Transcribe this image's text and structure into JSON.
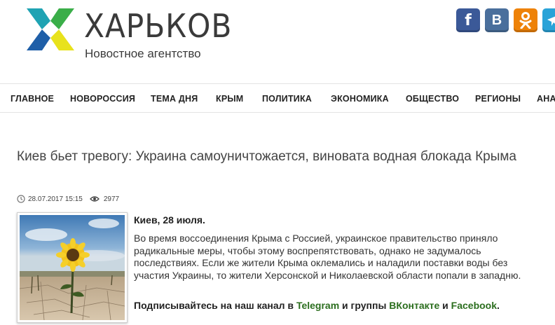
{
  "header": {
    "logo_title": "ХАРЬКОВ",
    "logo_subtitle": "Новостное агентство",
    "social": [
      {
        "name": "facebook",
        "glyph": "f",
        "color": "#3b5998"
      },
      {
        "name": "vkontakte",
        "glyph": "В",
        "color": "#4a6f9c"
      },
      {
        "name": "odnoklassniki",
        "glyph": "ок",
        "color": "#ee8208"
      },
      {
        "name": "telegram",
        "glyph": "➤",
        "color": "#2aa3d8"
      }
    ]
  },
  "nav": {
    "items": [
      "ГЛАВНОЕ",
      "НОВОРОССИЯ",
      "ТЕМА ДНЯ",
      "КРЫМ",
      "ПОЛИТИКА",
      "ЭКОНОМИКА",
      "ОБЩЕСТВО",
      "РЕГИОНЫ",
      "АНА"
    ]
  },
  "article": {
    "title": "Киев бьет тревогу: Украина самоуничтожается, виновата водная блокада Крыма",
    "date": "28.07.2017 15:15",
    "views": "2977",
    "dateline": "Киев, 28 июля.",
    "body": "Во время воссоединения Крыма с Россией, украинское правительство приняло радикальные меры, чтобы этому воспрепятствовать, однако не задумалось последствиях. Если же жители Крыма оклемались и наладили поставки воды без участия Украины, то жители Херсонской и Николаевской области попали в западню.",
    "subscribe": {
      "prefix": "Подписывайтесь на наш канал в ",
      "telegram": "Telegram",
      "middle": " и группы ",
      "vk": "ВКонтакте",
      "and": " и ",
      "facebook": "Facebook",
      "end": "."
    }
  },
  "colors": {
    "link_green": "#2b6e1e",
    "logo_blue": "#1f5fa8",
    "logo_green": "#3aae49",
    "logo_yellow": "#e8e21c",
    "logo_teal": "#1fa3b3"
  }
}
